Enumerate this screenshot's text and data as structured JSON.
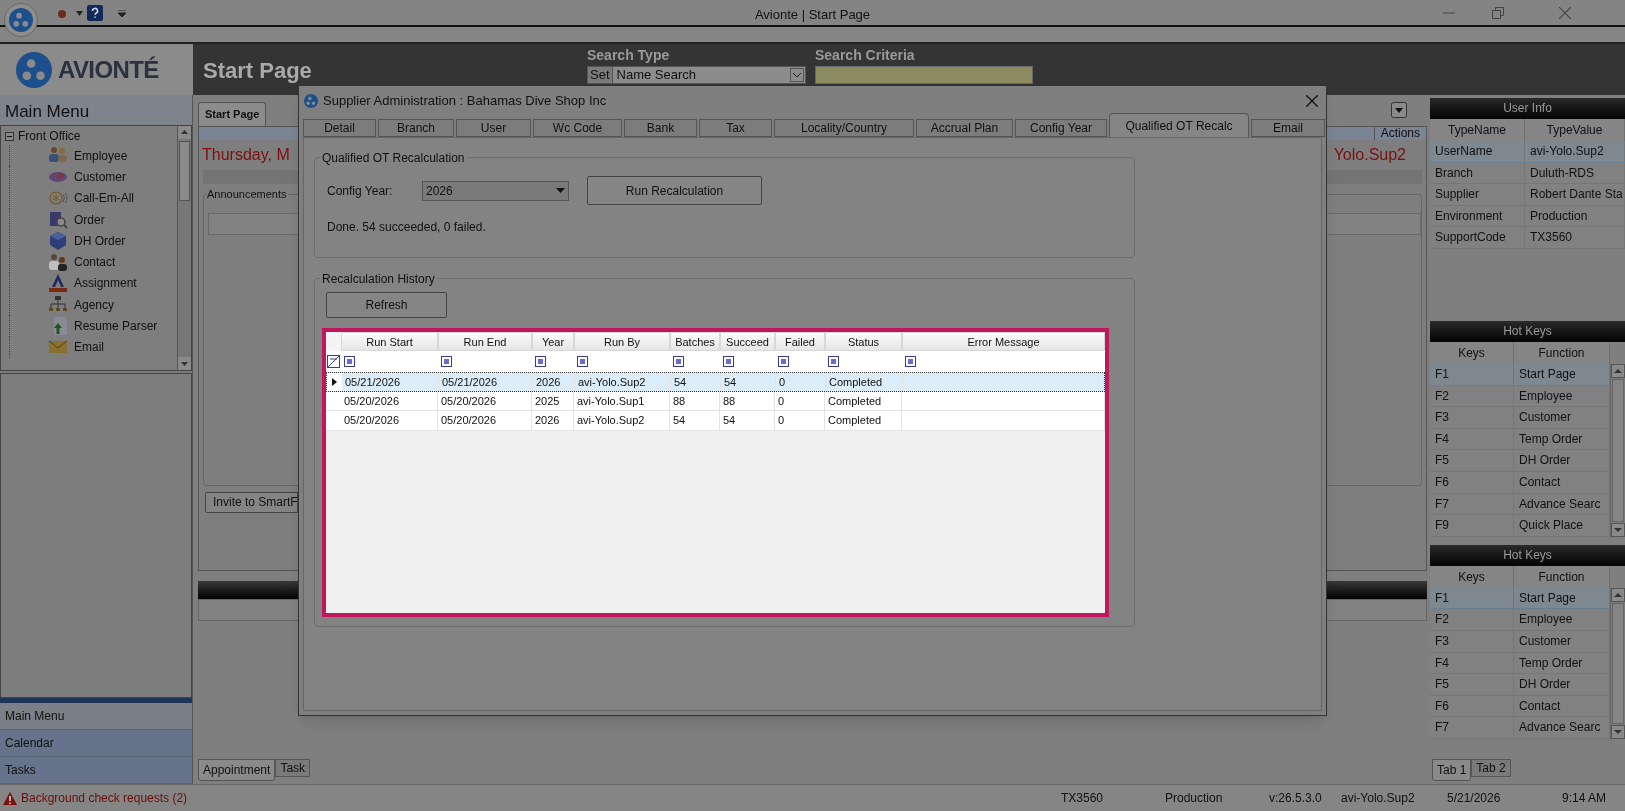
{
  "window": {
    "title": "Avionte | Start Page"
  },
  "header": {
    "logo": "AVIONTÉ",
    "page_title": "Start Page",
    "search_type": {
      "label": "Search Type",
      "set_button": "Set",
      "value": "Name Search"
    },
    "search_criteria": {
      "label": "Search Criteria"
    }
  },
  "main_menu": {
    "title": "Main Menu",
    "tree": [
      {
        "label": "Front Office",
        "expanded": true,
        "children": [
          {
            "label": "Employee"
          },
          {
            "label": "Customer"
          },
          {
            "label": "Call-Em-All"
          },
          {
            "label": "Order"
          },
          {
            "label": "DH Order"
          },
          {
            "label": "Contact"
          },
          {
            "label": "Assignment"
          },
          {
            "label": "Agency"
          },
          {
            "label": "Resume Parser"
          },
          {
            "label": "Email"
          }
        ]
      }
    ],
    "nav": [
      {
        "label": "Main Menu",
        "selected": true
      },
      {
        "label": "Calendar",
        "selected": false
      },
      {
        "label": "Tasks",
        "selected": false
      }
    ]
  },
  "start_page": {
    "tab": "Start Page",
    "actions": "Actions",
    "date": "Thursday, M",
    "user": "Yolo.Sup2",
    "announcements": "Announcements",
    "invite_button": "Invite to SmartF",
    "bottom_tabs": [
      {
        "label": "Appointment",
        "selected": true
      },
      {
        "label": "Task",
        "selected": false
      }
    ]
  },
  "dialog": {
    "title": "Supplier Administration : Bahamas Dive Shop Inc",
    "tabs": [
      {
        "label": "Detail",
        "selected": false
      },
      {
        "label": "Branch",
        "selected": false
      },
      {
        "label": "User",
        "selected": false
      },
      {
        "label": "Wc Code",
        "selected": false
      },
      {
        "label": "Bank",
        "selected": false
      },
      {
        "label": "Tax",
        "selected": false
      },
      {
        "label": "Locality/Country",
        "selected": false
      },
      {
        "label": "Accrual Plan",
        "selected": false
      },
      {
        "label": "Config Year",
        "selected": false
      },
      {
        "label": "Qualified OT Recalc",
        "selected": true
      },
      {
        "label": "Email",
        "selected": false
      }
    ],
    "recalc_group": {
      "title": "Qualified OT Recalculation",
      "config_year_label": "Config Year:",
      "config_year": "2026",
      "run_button": "Run Recalculation",
      "result": "Done. 54 succeeded, 0 failed."
    },
    "history_group": {
      "title": "Recalculation History",
      "refresh_button": "Refresh",
      "table": {
        "columns": [
          "Run Start",
          "Run End",
          "Year",
          "Run By",
          "Batches",
          "Succeed",
          "Failed",
          "Status",
          "Error Message"
        ],
        "rows": [
          {
            "selected": true,
            "cells": [
              "05/21/2026",
              "05/21/2026",
              "2026",
              "avi-Yolo.Sup2",
              "54",
              "54",
              "0",
              "Completed"
            ]
          },
          {
            "selected": false,
            "cells": [
              "05/20/2026",
              "05/20/2026",
              "2025",
              "avi-Yolo.Sup1",
              "88",
              "88",
              "0",
              "Completed"
            ]
          },
          {
            "selected": false,
            "cells": [
              "05/20/2026",
              "05/20/2026",
              "2026",
              "avi-Yolo.Sup2",
              "54",
              "54",
              "0",
              "Completed"
            ]
          }
        ]
      }
    }
  },
  "user_info": {
    "title": "User Info",
    "columns": [
      "TypeName",
      "TypeValue"
    ],
    "rows": [
      {
        "selected": true,
        "cells": [
          "UserName",
          "avi-Yolo.Sup2"
        ]
      },
      {
        "selected": false,
        "cells": [
          "Branch",
          "Duluth-RDS"
        ]
      },
      {
        "selected": false,
        "cells": [
          "Supplier",
          "Robert Dante Sta"
        ]
      },
      {
        "selected": false,
        "cells": [
          "Environment",
          "Production"
        ]
      },
      {
        "selected": false,
        "cells": [
          "SupportCode",
          "TX3560"
        ]
      }
    ]
  },
  "hot_keys": [
    {
      "title": "Hot Keys",
      "columns": [
        "Keys",
        "Function"
      ],
      "rows": [
        {
          "selected": true,
          "cells": [
            "F1",
            "Start Page"
          ]
        },
        {
          "selected": false,
          "cells": [
            "F2",
            "Employee"
          ]
        },
        {
          "selected": false,
          "cells": [
            "F3",
            "Customer"
          ]
        },
        {
          "selected": false,
          "cells": [
            "F4",
            "Temp Order"
          ]
        },
        {
          "selected": false,
          "cells": [
            "F5",
            "DH Order"
          ]
        },
        {
          "selected": false,
          "cells": [
            "F6",
            "Contact"
          ]
        },
        {
          "selected": false,
          "cells": [
            "F7",
            "Advance Searc"
          ]
        },
        {
          "selected": false,
          "cells": [
            "F9",
            "Quick Place"
          ]
        }
      ]
    },
    {
      "title": "Hot Keys",
      "columns": [
        "Keys",
        "Function"
      ],
      "rows": [
        {
          "selected": true,
          "cells": [
            "F1",
            "Start Page"
          ]
        },
        {
          "selected": false,
          "cells": [
            "F2",
            "Employee"
          ]
        },
        {
          "selected": false,
          "cells": [
            "F3",
            "Customer"
          ]
        },
        {
          "selected": false,
          "cells": [
            "F4",
            "Temp Order"
          ]
        },
        {
          "selected": false,
          "cells": [
            "F5",
            "DH Order"
          ]
        },
        {
          "selected": false,
          "cells": [
            "F6",
            "Contact"
          ]
        },
        {
          "selected": false,
          "cells": [
            "F7",
            "Advance Searc"
          ]
        }
      ]
    }
  ],
  "right_tabs": [
    {
      "label": "Tab 1",
      "selected": true
    },
    {
      "label": "Tab 2",
      "selected": false
    }
  ],
  "status_bar": {
    "alert": "Background check requests (2)",
    "items": [
      "TX3560",
      "Production",
      "v:26.5.3.0",
      "avi-Yolo.Sup2",
      "5/21/2026",
      "9:14 AM"
    ]
  }
}
